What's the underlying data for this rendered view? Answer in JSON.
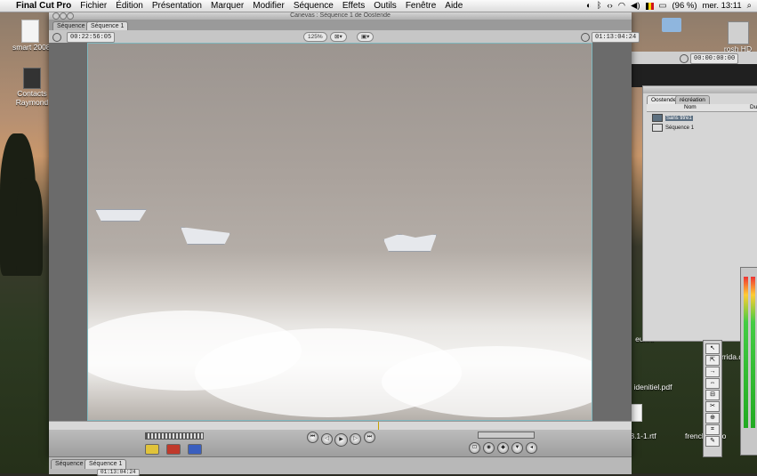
{
  "menubar": {
    "apple": "",
    "app": "Final Cut Pro",
    "items": [
      "Fichier",
      "Édition",
      "Présentation",
      "Marquer",
      "Modifier",
      "Séquence",
      "Effets",
      "Outils",
      "Fenêtre",
      "Aide"
    ],
    "battery": "(96 %)",
    "clock": "mer. 13:11"
  },
  "desktop": {
    "icons": [
      "smart 2008",
      "Contacts",
      "Raymond",
      "rosh HD",
      "eur.rtf",
      "rrida.d",
      "idenitiel.pdf",
      "8.1-1.rtf",
      "french vidéo"
    ]
  },
  "canvas": {
    "title": "Canevas : Séquence 1 de Oostende",
    "tabs": [
      "Séquence 1",
      "Séquence 1"
    ],
    "timecode_left": "00:22:56:05",
    "zoom": "125%",
    "timecode_right": "01:13:04:24"
  },
  "viewer_behind": {
    "timecode": "00:00:00:00"
  },
  "browser": {
    "tabs": [
      "Oostende",
      "récréation"
    ],
    "column_name": "Nom",
    "column_dur": "Dur",
    "items": [
      "Sans titre1",
      "Séquence 1"
    ]
  },
  "timeline": {
    "tabs": [
      "Séquence 1",
      "Séquence 1"
    ],
    "timecode": "01:13:04:24"
  },
  "colors": {
    "frame_border": "#7fb8bf",
    "menubar": "#e8e8e8"
  }
}
